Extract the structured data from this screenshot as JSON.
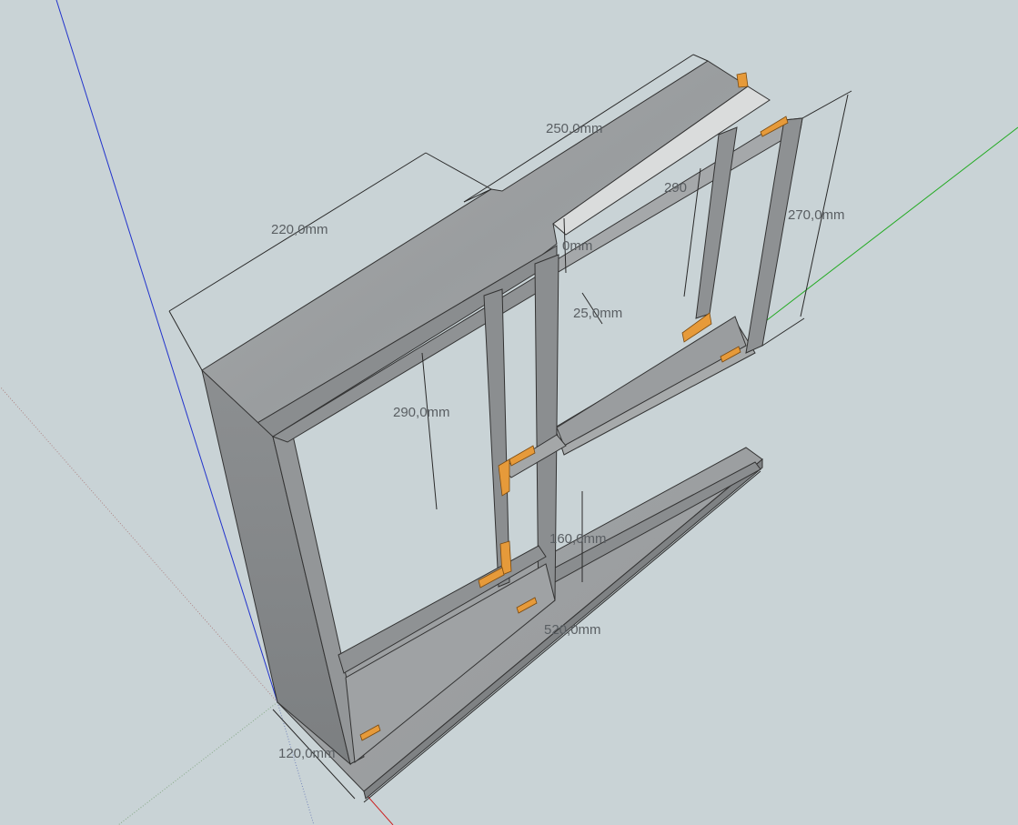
{
  "dimensions": {
    "top_length": "250,0mm",
    "side_depth": "220,0mm",
    "right_height": "270,0mm",
    "right_inner_height": "290",
    "small_gap": "0mm",
    "frame_width": "25,0mm",
    "left_inner_height": "290,0mm",
    "lower_height": "160,0mm",
    "base_length": "520,0mm",
    "base_depth": "120,0mm"
  },
  "colors": {
    "background": "#c9d3d6",
    "panel": "#9ea1a3",
    "panel_dark": "#7d8082",
    "bracket": "#e69a3a",
    "axis_blue": "#2233cc",
    "axis_green": "#22aa22",
    "axis_red": "#cc2222"
  }
}
